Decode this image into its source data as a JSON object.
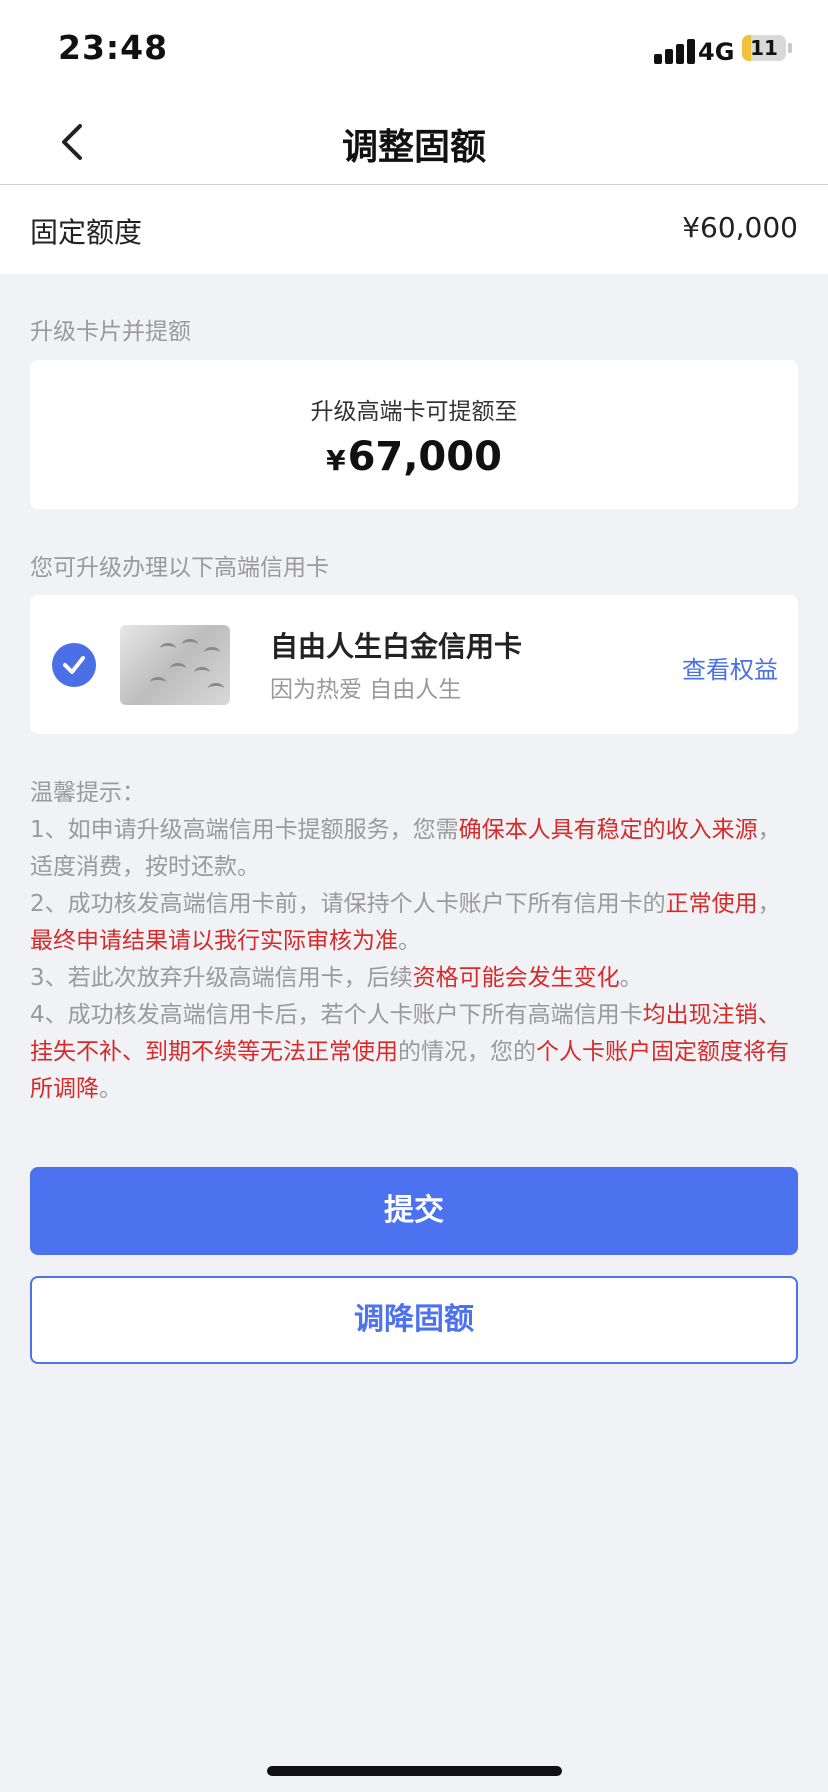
{
  "status_bar": {
    "time": "23:48",
    "network": "4G",
    "battery": "11"
  },
  "nav": {
    "title": "调整固额",
    "back_icon": "chevron-left-icon"
  },
  "fixed_limit": {
    "label": "固定额度",
    "value": "¥60,000"
  },
  "upgrade": {
    "section_label": "升级卡片并提额",
    "line": "升级高端卡可提额至",
    "currency": "¥",
    "amount": "67,000"
  },
  "cards": {
    "section_label": "您可升级办理以下高端信用卡",
    "items": [
      {
        "name": "自由人生白金信用卡",
        "subtitle": "因为热爱 自由人生",
        "link": "查看权益",
        "selected": true
      }
    ]
  },
  "tips": {
    "title": "温馨提示：",
    "lines": [
      [
        {
          "text": "1、如申请升级高端信用卡提额服务，您需",
          "red": false
        },
        {
          "text": "确保本人具有稳定的收入来源",
          "red": true
        },
        {
          "text": "，适度消费，按时还款。",
          "red": false
        }
      ],
      [
        {
          "text": "2、成功核发高端信用卡前，请保持个人卡账户下所有信用卡的",
          "red": false
        },
        {
          "text": "正常使用",
          "red": true
        },
        {
          "text": "，",
          "red": false
        },
        {
          "text": "最终申请结果请以我行实际审核为准",
          "red": true
        },
        {
          "text": "。",
          "red": false
        }
      ],
      [
        {
          "text": "3、若此次放弃升级高端信用卡，后续",
          "red": false
        },
        {
          "text": "资格可能会发生变化",
          "red": true
        },
        {
          "text": "。",
          "red": false
        }
      ],
      [
        {
          "text": "4、成功核发高端信用卡后，若个人卡账户下所有高端信用卡",
          "red": false
        },
        {
          "text": "均出现注销、挂失不补、到期不续等无法正常使用",
          "red": true
        },
        {
          "text": "的情况，您的",
          "red": false
        },
        {
          "text": "个人卡账户固定额度将有所调降",
          "red": true
        },
        {
          "text": "。",
          "red": false
        }
      ]
    ]
  },
  "buttons": {
    "submit": "提交",
    "lower": "调降固额"
  },
  "colors": {
    "accent": "#4c72ef",
    "warning_red": "#d62b2b"
  }
}
